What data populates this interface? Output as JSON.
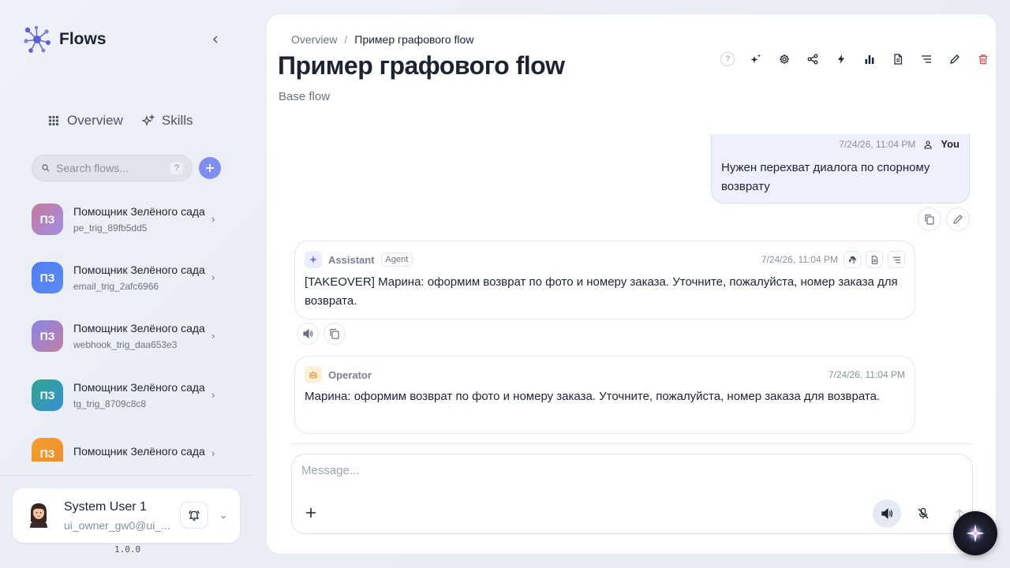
{
  "app": {
    "name": "Flows",
    "version": "1.0.0"
  },
  "nav": [
    {
      "label": "Overview",
      "icon": "grid-icon"
    },
    {
      "label": "Skills",
      "icon": "sparkles-icon"
    }
  ],
  "search": {
    "placeholder": "Search flows...",
    "help": "?"
  },
  "flows": [
    {
      "initials": "ПЗ",
      "title": "Помощник Зелёного сада",
      "id": "pe_trig_89fb5dd5",
      "color_from": "#c6799a",
      "color_to": "#9f8fe6"
    },
    {
      "initials": "ПЗ",
      "title": "Помощник Зелёного сада",
      "id": "email_trig_2afc6966",
      "color_from": "#4f7df3",
      "color_to": "#5b8cf5"
    },
    {
      "initials": "ПЗ",
      "title": "Помощник Зелёного сада",
      "id": "webhook_trig_daa653e3",
      "color_from": "#8a84e8",
      "color_to": "#c17fa0"
    },
    {
      "initials": "ПЗ",
      "title": "Помощник Зелёного сада",
      "id": "tg_trig_8709c8c8",
      "color_from": "#2ea58f",
      "color_to": "#3a8fd6"
    },
    {
      "initials": "ПЗ",
      "title": "Помощник Зелёного сада",
      "id": "",
      "color_from": "#f2a02e",
      "color_to": "#f08b2a"
    }
  ],
  "user": {
    "name": "System User 1",
    "email": "ui_owner_gw0@ui_..."
  },
  "breadcrumb": {
    "root": "Overview",
    "separator": "/",
    "current": "Пример графового flow"
  },
  "page": {
    "title": "Пример графового flow",
    "subtitle": "Base flow"
  },
  "toolbar": {
    "help": "?",
    "icons": [
      "sparkles-icon",
      "gear-icon",
      "share-icon",
      "bolt-icon",
      "bar-chart-icon",
      "document-icon",
      "list-icon",
      "pencil-icon",
      "trash-icon"
    ]
  },
  "messages": {
    "user": {
      "time": "7/24/26, 11:04 PM",
      "author": "You",
      "text": "Нужен перехват диалога по спорному возврату"
    },
    "assistant": {
      "role": "Assistant",
      "badge": "Agent",
      "time": "7/24/26, 11:04 PM",
      "text": "[TAKEOVER] Марина: оформим возврат по фото и номеру заказа. Уточните, пожалуйста, номер заказа для возврата."
    },
    "operator": {
      "role": "Operator",
      "time": "7/24/26, 11:04 PM",
      "text": "Марина: оформим возврат по фото и номеру заказа. Уточните, пожалуйста, номер заказа для возврата."
    }
  },
  "composer": {
    "placeholder": "Message..."
  },
  "colors": {
    "accent": "#7f8ef0",
    "danger": "#e5484d",
    "user_bubble": "#eef0fd"
  }
}
